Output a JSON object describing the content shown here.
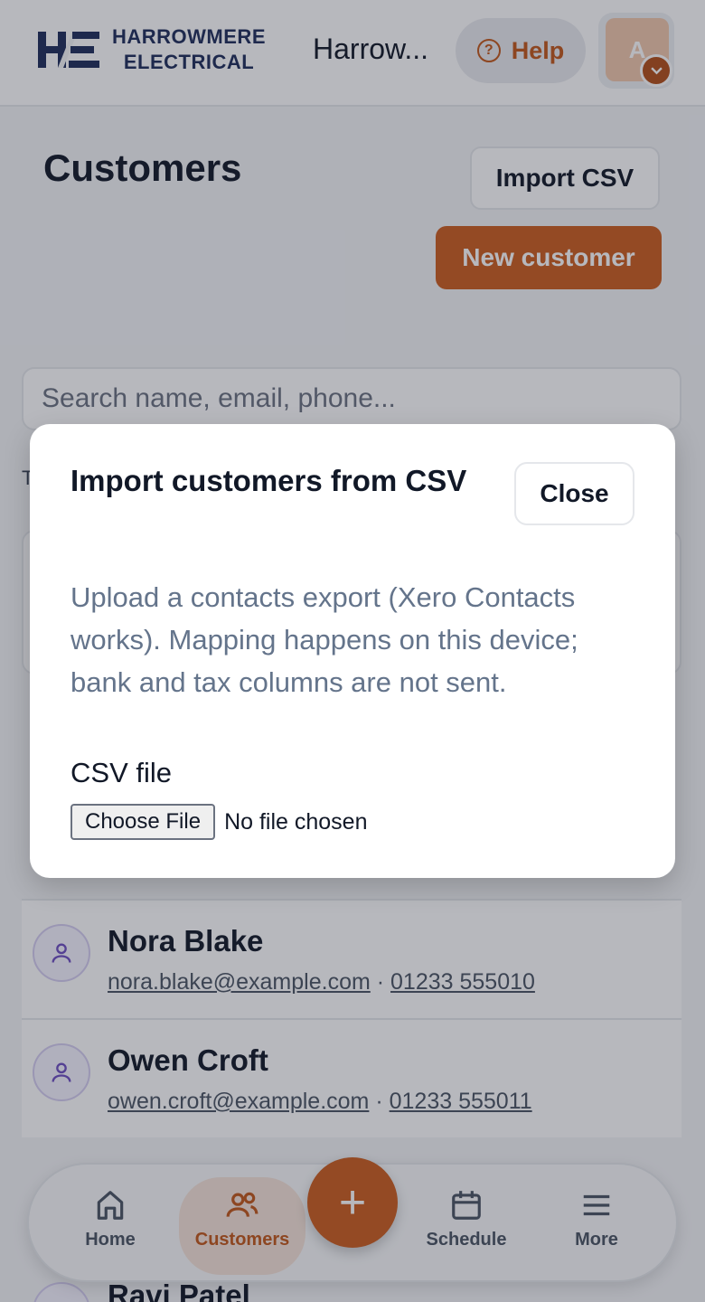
{
  "header": {
    "logo_line1": "HARROWMERE",
    "logo_line2": "ELECTRICAL",
    "org_name": "Harrow...",
    "help_label": "Help",
    "avatar_initial": "A"
  },
  "page": {
    "title": "Customers",
    "import_label": "Import CSV",
    "new_label": "New customer",
    "search_placeholder": "Search name, email, phone...",
    "stray_text": "T"
  },
  "customers": [
    {
      "name": "Nora Blake",
      "email": "nora.blake@example.com",
      "phone": "01233 555010"
    },
    {
      "name": "Owen Croft",
      "email": "owen.croft@example.com",
      "phone": "01233 555011"
    }
  ],
  "partial_customer": {
    "name": "Ravi Patel"
  },
  "nav": {
    "home": "Home",
    "customers": "Customers",
    "schedule": "Schedule",
    "more": "More",
    "fab": "+"
  },
  "modal": {
    "title": "Import customers from CSV",
    "close_label": "Close",
    "description": "Upload a contacts export (Xero Contacts works). Mapping happens on this device; bank and tax columns are not sent.",
    "file_label": "CSV file",
    "choose_label": "Choose File",
    "no_file": "No file chosen"
  },
  "colors": {
    "accent": "#cc5d1e",
    "brand_navy": "#1e2d5a"
  },
  "icons": [
    "help-icon",
    "chevron-down-icon",
    "user-icon",
    "home-icon",
    "users-icon",
    "plus-icon",
    "calendar-icon",
    "menu-icon"
  ]
}
